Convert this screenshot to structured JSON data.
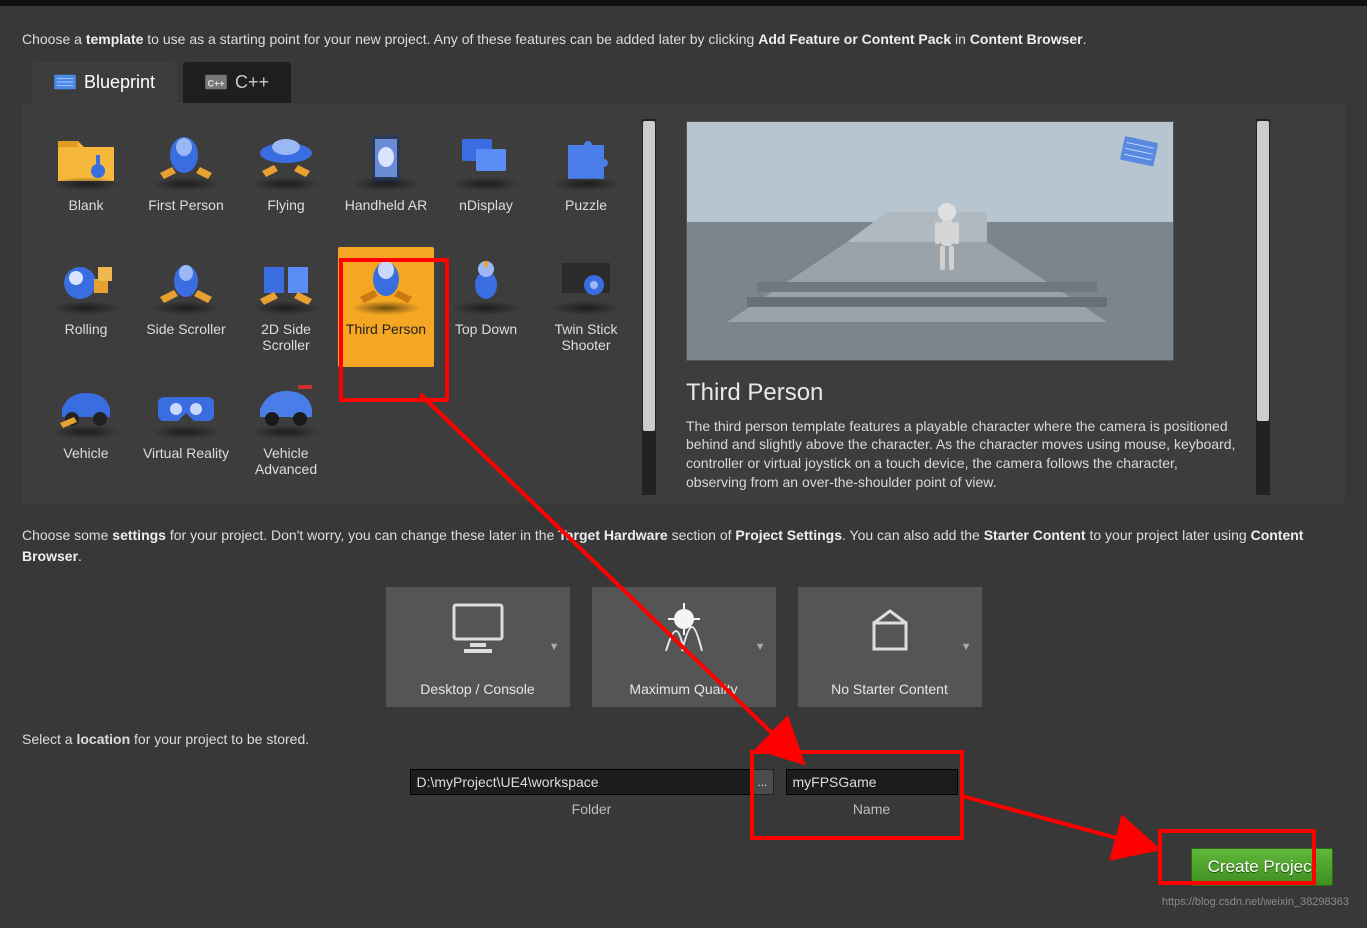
{
  "intro": {
    "prefix": "Choose a ",
    "bold1": "template",
    "mid": " to use as a starting point for your new project.  Any of these features can be added later by clicking ",
    "bold2": "Add Feature or Content Pack",
    "mid2": " in ",
    "bold3": "Content Browser",
    "suffix": "."
  },
  "tabs": {
    "blueprint": "Blueprint",
    "cpp": "C++"
  },
  "templates": [
    {
      "label": "Blank"
    },
    {
      "label": "First Person"
    },
    {
      "label": "Flying"
    },
    {
      "label": "Handheld AR"
    },
    {
      "label": "nDisplay"
    },
    {
      "label": "Puzzle"
    },
    {
      "label": "Rolling"
    },
    {
      "label": "Side Scroller"
    },
    {
      "label": "2D Side Scroller"
    },
    {
      "label": "Third Person",
      "selected": true
    },
    {
      "label": "Top Down"
    },
    {
      "label": "Twin Stick Shooter"
    },
    {
      "label": "Vehicle"
    },
    {
      "label": "Virtual Reality"
    },
    {
      "label": "Vehicle Advanced"
    }
  ],
  "preview": {
    "title": "Third Person",
    "desc": "The third person template features a playable character where the camera is positioned behind and slightly above the character. As the character moves using mouse, keyboard, controller or virtual joystick on a touch device, the camera follows the character, observing from an over-the-shoulder point of view."
  },
  "mid": {
    "prefix": "Choose some ",
    "b1": "settings",
    "t1": " for your project.  Don't worry, you can change these later in the ",
    "b2": "Target Hardware",
    "t2": " section of ",
    "b3": "Project Settings",
    "t3": ".   You can also add the ",
    "b4": "Starter Content",
    "t4": " to your project later using ",
    "b5": "Content Browser",
    "suffix": "."
  },
  "settings": {
    "hardware": "Desktop / Console",
    "quality": "Maximum Quality",
    "starter": "No Starter Content"
  },
  "location": {
    "prefix": "Select a ",
    "b1": "location",
    "suffix": " for your project to be stored.",
    "folder_label": "Folder",
    "name_label": "Name",
    "folder_value": "D:\\myProject\\UE4\\workspace",
    "name_value": "myFPSGame",
    "browse": "..."
  },
  "create_label": "Create Project",
  "watermark": "https://blog.csdn.net/weixin_38298363"
}
